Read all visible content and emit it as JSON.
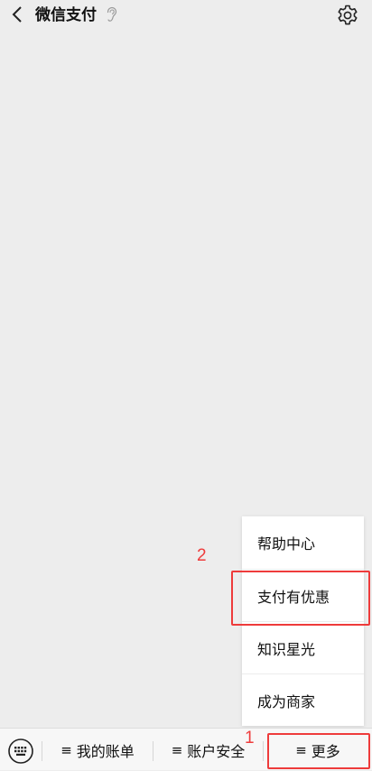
{
  "header": {
    "title": "微信支付"
  },
  "menu": {
    "items": [
      {
        "label": "帮助中心"
      },
      {
        "label": "支付有优惠"
      },
      {
        "label": "知识星光"
      },
      {
        "label": "成为商家"
      }
    ]
  },
  "bottom_bar": {
    "items": [
      {
        "label": "我的账单",
        "glyph": "≡"
      },
      {
        "label": "账户安全",
        "glyph": "≡"
      },
      {
        "label": "更多",
        "glyph": "≡"
      }
    ]
  },
  "annotations": {
    "step_1": "1",
    "step_2": "2",
    "color": "#ee3b3b"
  }
}
